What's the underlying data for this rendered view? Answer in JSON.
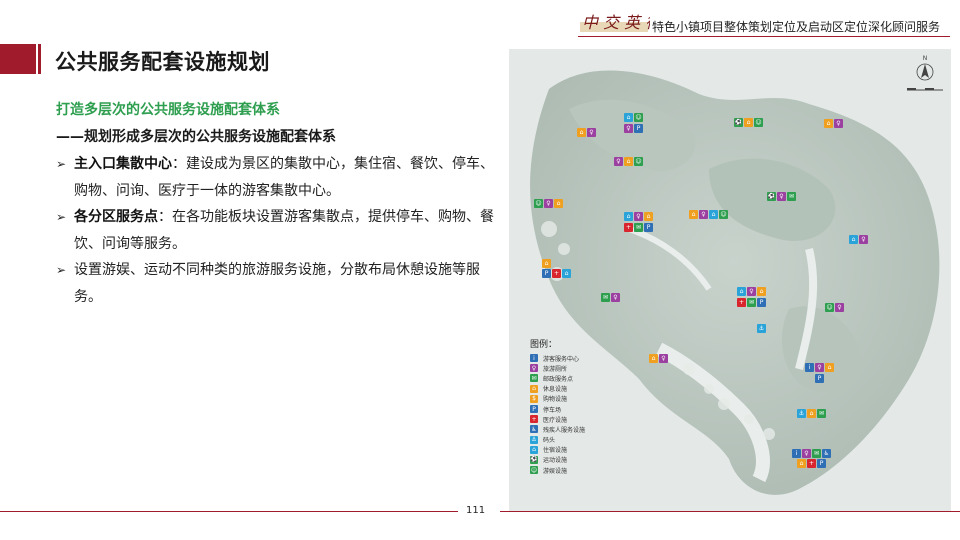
{
  "header": {
    "title": "特色小镇项目整体策划定位及启动区定位深化顾问服务"
  },
  "page": {
    "title": "公共服务配套设施规划",
    "subtitle_green": "打造多层次的公共服务设施配套体系",
    "subtitle_dark": "——规划形成多层次的公共服务设施配套体系",
    "page_number": "111"
  },
  "bullets": [
    {
      "key": "主入口集散中心",
      "text": "：建设成为景区的集散中心，集住宿、餐饮、停车、购物、问询、医疗于一体的游客集散中心。"
    },
    {
      "key": "各分区服务点",
      "text": "：在各功能板块设置游客集散点，提供停车、购物、餐饮、问询等服务。"
    },
    {
      "key": "",
      "text": "设置游娱、运动不同种类的旅游服务设施，分散布局休憩设施等服务。"
    }
  ],
  "map": {
    "legend_title": "图例：",
    "legend": [
      {
        "label": "游客服务中心",
        "icon": "info-icon",
        "glyph": "i",
        "color": "#2f6fb5"
      },
      {
        "label": "旅游厕所",
        "icon": "toilet-icon",
        "glyph": "♀",
        "color": "#9b3fa0"
      },
      {
        "label": "邮政服务点",
        "icon": "mail-icon",
        "glyph": "✉",
        "color": "#2e9e4f"
      },
      {
        "label": "休息设施",
        "icon": "rest-icon",
        "glyph": "⌂",
        "color": "#f0a020"
      },
      {
        "label": "购物设施",
        "icon": "shopping-icon",
        "glyph": "$",
        "color": "#f0a020"
      },
      {
        "label": "停车场",
        "icon": "parking-icon",
        "glyph": "P",
        "color": "#2f6fb5"
      },
      {
        "label": "医疗设施",
        "icon": "medical-icon",
        "glyph": "+",
        "color": "#d9262e"
      },
      {
        "label": "残疾人服务设施",
        "icon": "accessibility-icon",
        "glyph": "♿",
        "color": "#2f6fb5"
      },
      {
        "label": "码头",
        "icon": "pier-icon",
        "glyph": "⚓",
        "color": "#2aa3d9"
      },
      {
        "label": "住宿设施",
        "icon": "lodging-icon",
        "glyph": "⌂",
        "color": "#2aa3d9"
      },
      {
        "label": "运动设施",
        "icon": "sports-icon",
        "glyph": "⚽",
        "color": "#2e9e4f"
      },
      {
        "label": "游娱设施",
        "icon": "recreation-icon",
        "glyph": "☺",
        "color": "#2e9e4f"
      }
    ],
    "compass_label": "N"
  },
  "colors": {
    "accent_red": "#a01c2c",
    "accent_green": "#2e9e4f"
  }
}
